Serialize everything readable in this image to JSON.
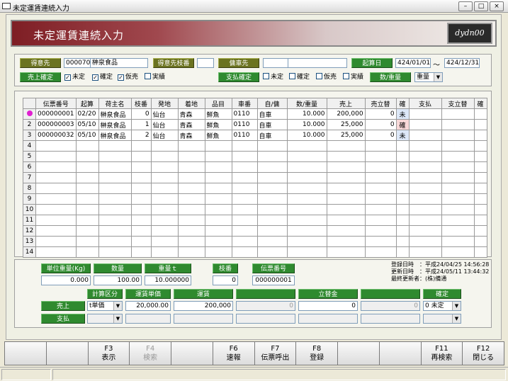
{
  "window": {
    "title": "未定運賃連続入力"
  },
  "header": {
    "title": "未定運賃連続入力",
    "logo": "dydn00"
  },
  "filters": {
    "tokuisaki_label": "得意先",
    "tokuisaki_code": "000070",
    "tokuisaki_name": "榊泉食品",
    "edaban_label": "得意先枝番",
    "edaban_value": "",
    "yosha_label": "傭車先",
    "yosha_code": "",
    "yosha_name": "",
    "kidate_label": "起算日",
    "date_from": "424/01/01",
    "tilde": "～",
    "date_to": "424/12/31",
    "uriage_label": "売上確定",
    "uriage_checks": [
      {
        "label": "未定",
        "checked": true
      },
      {
        "label": "確定",
        "checked": true
      },
      {
        "label": "仮売",
        "checked": true
      },
      {
        "label": "実績",
        "checked": false
      }
    ],
    "shiharai_label": "支払確定",
    "shiharai_checks": [
      {
        "label": "未定",
        "checked": false
      },
      {
        "label": "確定",
        "checked": false
      },
      {
        "label": "仮売",
        "checked": false
      },
      {
        "label": "実績",
        "checked": false
      }
    ],
    "suryo_label": "数/重量",
    "suryo_select": "重量"
  },
  "grid": {
    "columns": [
      "伝票番号",
      "起算",
      "荷主名",
      "枝番",
      "発地",
      "着地",
      "品目",
      "車番",
      "自/傭",
      "数/重量",
      "売上",
      "売立替",
      "確",
      "支払",
      "支立替",
      "確"
    ],
    "rows": [
      {
        "no": "",
        "denpyo": "000000001",
        "kisan": "02/20",
        "ninushi": "榊泉食品",
        "eda": "0",
        "hatsu": "仙台",
        "chaku": "青森",
        "hinmoku": "鮮魚",
        "shaban": "0110",
        "jiyo": "自車",
        "suryo": "10.000",
        "uriage": "200,000",
        "uritate": "0",
        "kaku": "未",
        "shiharai": "",
        "shitate": "",
        "kaku2": ""
      },
      {
        "no": "2",
        "denpyo": "000000003",
        "kisan": "05/10",
        "ninushi": "榊泉食品",
        "eda": "1",
        "hatsu": "仙台",
        "chaku": "青森",
        "hinmoku": "鮮魚",
        "shaban": "0110",
        "jiyo": "自車",
        "suryo": "10.000",
        "uriage": "25,000",
        "uritate": "0",
        "kaku": "確",
        "shiharai": "",
        "shitate": "",
        "kaku2": ""
      },
      {
        "no": "3",
        "denpyo": "000000032",
        "kisan": "05/10",
        "ninushi": "榊泉食品",
        "eda": "2",
        "hatsu": "仙台",
        "chaku": "青森",
        "hinmoku": "鮮魚",
        "shaban": "0110",
        "jiyo": "自車",
        "suryo": "10.000",
        "uriage": "25,000",
        "uritate": "0",
        "kaku": "未",
        "shiharai": "",
        "shitate": "",
        "kaku2": ""
      },
      {
        "no": "4"
      },
      {
        "no": "5"
      },
      {
        "no": "6"
      },
      {
        "no": "7"
      },
      {
        "no": "8"
      },
      {
        "no": "9"
      },
      {
        "no": "10"
      },
      {
        "no": "11"
      },
      {
        "no": "12"
      },
      {
        "no": "13"
      },
      {
        "no": "14"
      }
    ]
  },
  "detail": {
    "tani_label": "単位重量(Kg)",
    "tani_value": "0.000",
    "suryo_label": "数量",
    "suryo_value": "100.00",
    "juryo_label": "重量ｔ",
    "juryo_value": "10.000000",
    "eda_label": "枝番",
    "eda_value": "0",
    "denpyo_label": "伝票番号",
    "denpyo_value": "000000001"
  },
  "audit": {
    "line1": "登録日時　：平成24/04/25 14:56:28",
    "line2": "更新日時　：平成24/05/11 13:44:32",
    "line3": "最終更新者：(株)備通"
  },
  "calc": {
    "keisan_label": "計算区分",
    "tanka_label": "運賃単価",
    "unchin_label": "運賃",
    "tatekae_label": "立替金",
    "kakutei_label": "確定",
    "uriage_label": "売上",
    "shiharai_label": "支払",
    "uriage_keisan": "t単価",
    "uriage_tanka": "20,000.00",
    "uriage_unchin": "200,000",
    "uriage_blank1": "0",
    "uriage_tatekae": "0",
    "uriage_blank2": "0",
    "uriage_kakutei": "0 未定"
  },
  "fkeys": [
    {
      "key": "",
      "label": ""
    },
    {
      "key": "",
      "label": ""
    },
    {
      "key": "F3",
      "label": "表示"
    },
    {
      "key": "F4",
      "label": "検索"
    },
    {
      "key": "",
      "label": ""
    },
    {
      "key": "F6",
      "label": "速報"
    },
    {
      "key": "F7",
      "label": "伝票呼出"
    },
    {
      "key": "F8",
      "label": "登録"
    },
    {
      "key": "",
      "label": ""
    },
    {
      "key": "",
      "label": ""
    },
    {
      "key": "F11",
      "label": "再検索"
    },
    {
      "key": "F12",
      "label": "閉じる"
    }
  ],
  "colors": {
    "green": "#2f8a2f",
    "olive": "#6b7320",
    "header": "#7e1e24"
  }
}
